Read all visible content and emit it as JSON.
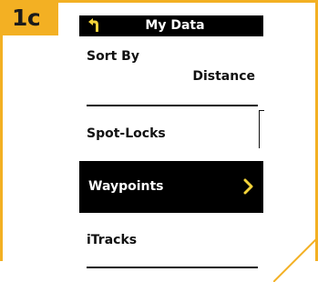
{
  "step": {
    "badge": "1c"
  },
  "header": {
    "title": "My Data",
    "back_icon": "back-arrow-icon"
  },
  "menu": {
    "items": [
      {
        "label": "Sort By",
        "value": "Distance"
      },
      {
        "label": "Spot-Locks"
      },
      {
        "label": "Waypoints",
        "selected": true,
        "icon": "chevron-right-icon"
      },
      {
        "label": "iTracks"
      }
    ]
  },
  "colors": {
    "accent": "#f3b023",
    "header_bg": "#000000",
    "selected_bg": "#000000",
    "selected_chevron": "#f3d33a",
    "text": "#111111"
  }
}
